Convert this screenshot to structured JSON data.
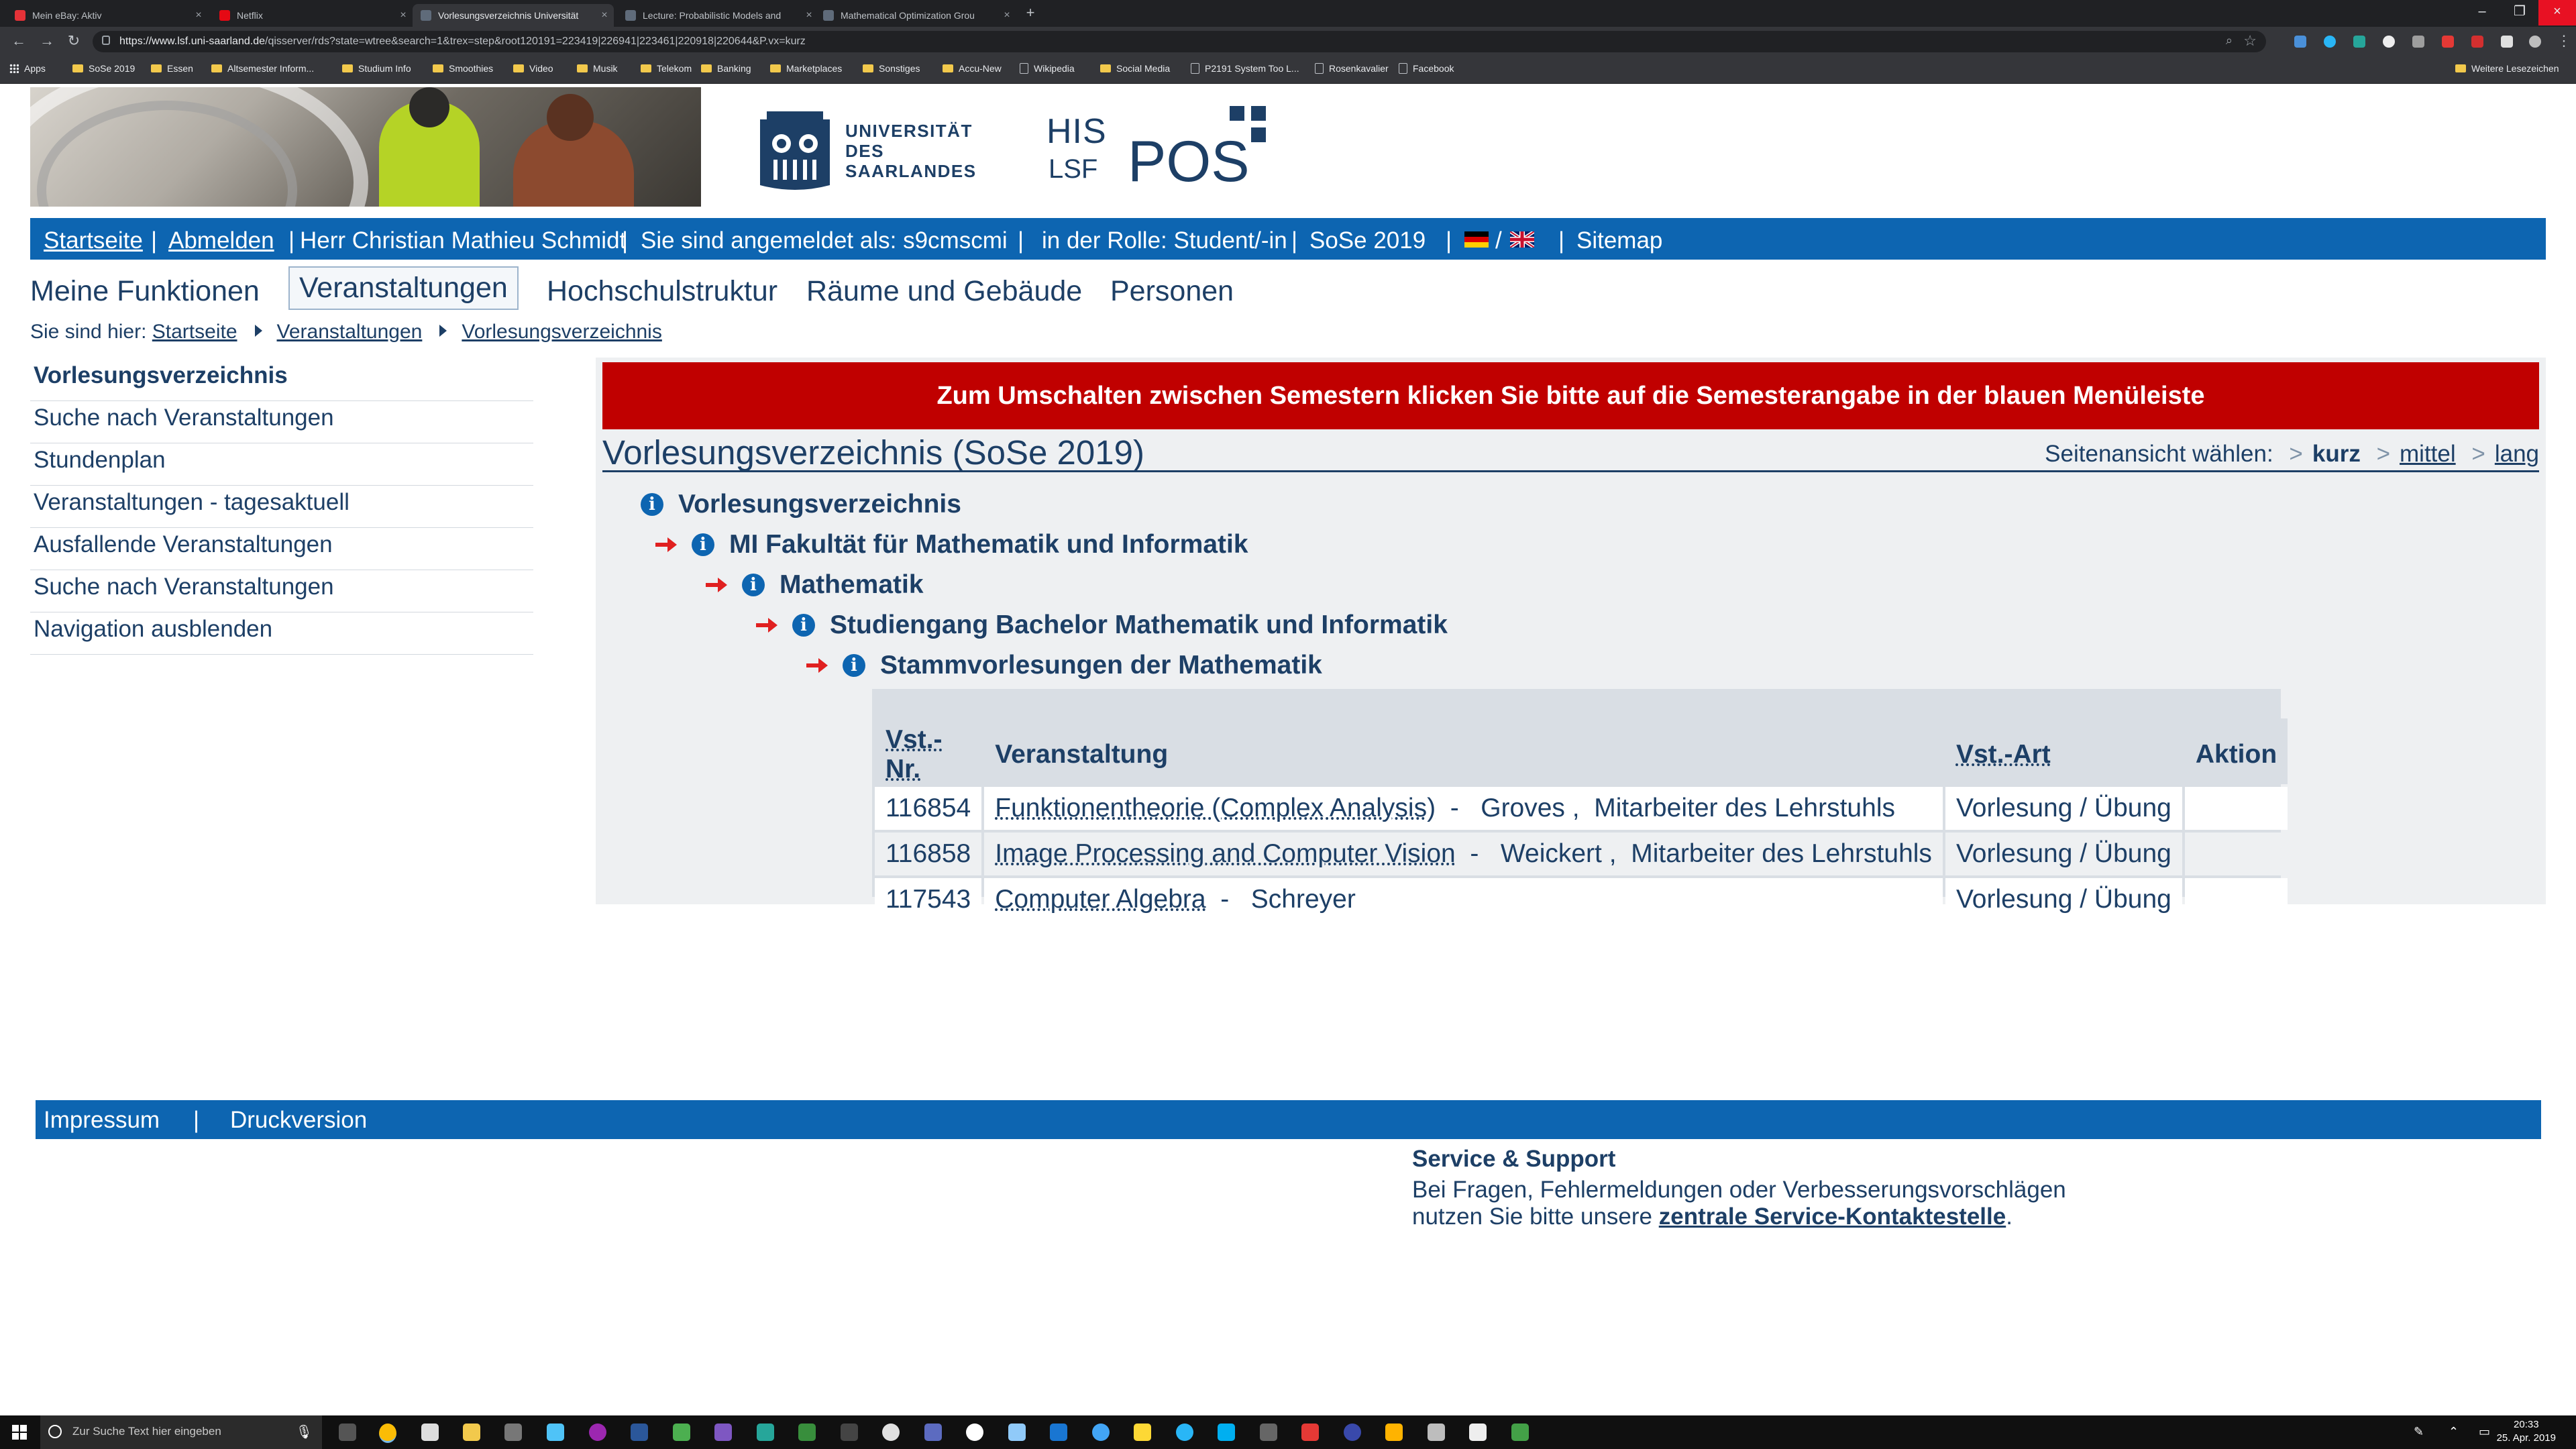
{
  "browser": {
    "tabs": [
      {
        "label": "Mein eBay: Aktiv",
        "favicon_color": "#e53238",
        "active": false
      },
      {
        "label": "Netflix",
        "favicon_color": "#e50914",
        "active": false
      },
      {
        "label": "Vorlesungsverzeichnis Universität",
        "favicon_color": "#5f6b7a",
        "active": true
      },
      {
        "label": "Lecture: Probabilistic Models and",
        "favicon_color": "#5f6b7a",
        "active": false
      },
      {
        "label": "Mathematical Optimization Grou",
        "favicon_color": "#5f6b7a",
        "active": false
      }
    ],
    "url_domain": "https://www.lsf.uni-saarland.de",
    "url_path": "/qisserver/rds?state=wtree&search=1&trex=step&root120191=223419|226941|223461|220918|220644&P.vx=kurz",
    "bookmarks": [
      {
        "label": "Apps",
        "type": "grid"
      },
      {
        "label": "SoSe 2019",
        "type": "folder"
      },
      {
        "label": "Essen",
        "type": "folder"
      },
      {
        "label": "Altsemester Inform...",
        "type": "folder"
      },
      {
        "label": "Studium Info",
        "type": "folder"
      },
      {
        "label": "Smoothies",
        "type": "folder"
      },
      {
        "label": "Video",
        "type": "folder"
      },
      {
        "label": "Musik",
        "type": "folder"
      },
      {
        "label": "Telekom",
        "type": "folder"
      },
      {
        "label": "Banking",
        "type": "folder"
      },
      {
        "label": "Marketplaces",
        "type": "folder"
      },
      {
        "label": "Sonstiges",
        "type": "folder"
      },
      {
        "label": "Accu-New",
        "type": "folder"
      },
      {
        "label": "Wikipedia",
        "type": "page"
      },
      {
        "label": "Social Media",
        "type": "folder"
      },
      {
        "label": "P2191 System Too L...",
        "type": "page"
      },
      {
        "label": "Rosenkavalier",
        "type": "page"
      },
      {
        "label": "Facebook",
        "type": "page"
      }
    ],
    "other_bookmarks": "Weitere Lesezeichen"
  },
  "header": {
    "university_line1": "UNIVERSITÄT",
    "university_line2": "DES",
    "university_line3": "SAARLANDES",
    "his": "HIS",
    "lsf": "LSF",
    "pos": "POS"
  },
  "bluebar": {
    "startseite": "Startseite",
    "abmelden": "Abmelden",
    "user": "Herr Christian Mathieu Schmidt",
    "logged_in_as": "Sie sind angemeldet als: s9cmscmi",
    "role": "in der Rolle: Student/-in",
    "semester": "SoSe 2019",
    "lang_sep": "/",
    "sitemap": "Sitemap"
  },
  "mainnav": [
    "Meine Funktionen",
    "Veranstaltungen",
    "Hochschulstruktur",
    "Räume und Gebäude",
    "Personen"
  ],
  "breadcrumb": {
    "prefix": "Sie sind hier:",
    "items": [
      "Startseite",
      "Veranstaltungen",
      "Vorlesungsverzeichnis"
    ]
  },
  "sidenav": [
    "Vorlesungsverzeichnis",
    "Suche nach Veranstaltungen",
    "Stundenplan",
    "Veranstaltungen - tagesaktuell",
    "Ausfallende Veranstaltungen",
    "Suche nach Veranstaltungen",
    "Navigation ausblenden"
  ],
  "content": {
    "notice": "Zum Umschalten zwischen Semestern klicken Sie bitte auf die Semesterangabe in der blauen Menüleiste",
    "title": "Vorlesungsverzeichnis (SoSe 2019)",
    "view_label": "Seitenansicht wählen:",
    "view_options": [
      "kurz",
      "mittel",
      "lang"
    ],
    "tree": [
      "Vorlesungsverzeichnis",
      "MI Fakultät für Mathematik und Informatik",
      "Mathematik",
      "Studiengang Bachelor Mathematik und Informatik",
      "Stammvorlesungen der Mathematik"
    ],
    "table": {
      "headers": [
        "Vst.-Nr.",
        "Veranstaltung",
        "Vst.-Art",
        "Aktion"
      ],
      "rows": [
        {
          "nr": "116854",
          "title": "Funktionentheorie (Complex Analysis)",
          "people": "  -   Groves ,  Mitarbeiter des Lehrstuhls",
          "art": "Vorlesung / Übung"
        },
        {
          "nr": "116858",
          "title": "Image Processing and Computer Vision",
          "people": "  -   Weickert ,  Mitarbeiter des Lehrstuhls",
          "art": "Vorlesung / Übung"
        },
        {
          "nr": "117543",
          "title": "Computer Algebra",
          "people": "  -   Schreyer",
          "art": "Vorlesung / Übung"
        }
      ]
    }
  },
  "footer": {
    "impressum": "Impressum",
    "sep": "|",
    "druckversion": "Druckversion",
    "support_title": "Service & Support",
    "support_line1": "Bei Fragen, Fehlermeldungen oder Verbesserungsvorschlägen",
    "support_line2_prefix": "nutzen Sie bitte unsere",
    "support_link": "zentrale Service-Kontaktestelle",
    "support_line2_suffix": "."
  },
  "taskbar": {
    "search_placeholder": "Zur Suche Text hier eingeben",
    "time": "20:33",
    "date": "25. Apr. 2019"
  },
  "colors": {
    "brand_blue": "#0d65b1",
    "text_navy": "#1d3f66",
    "notice_red": "#c00000"
  }
}
